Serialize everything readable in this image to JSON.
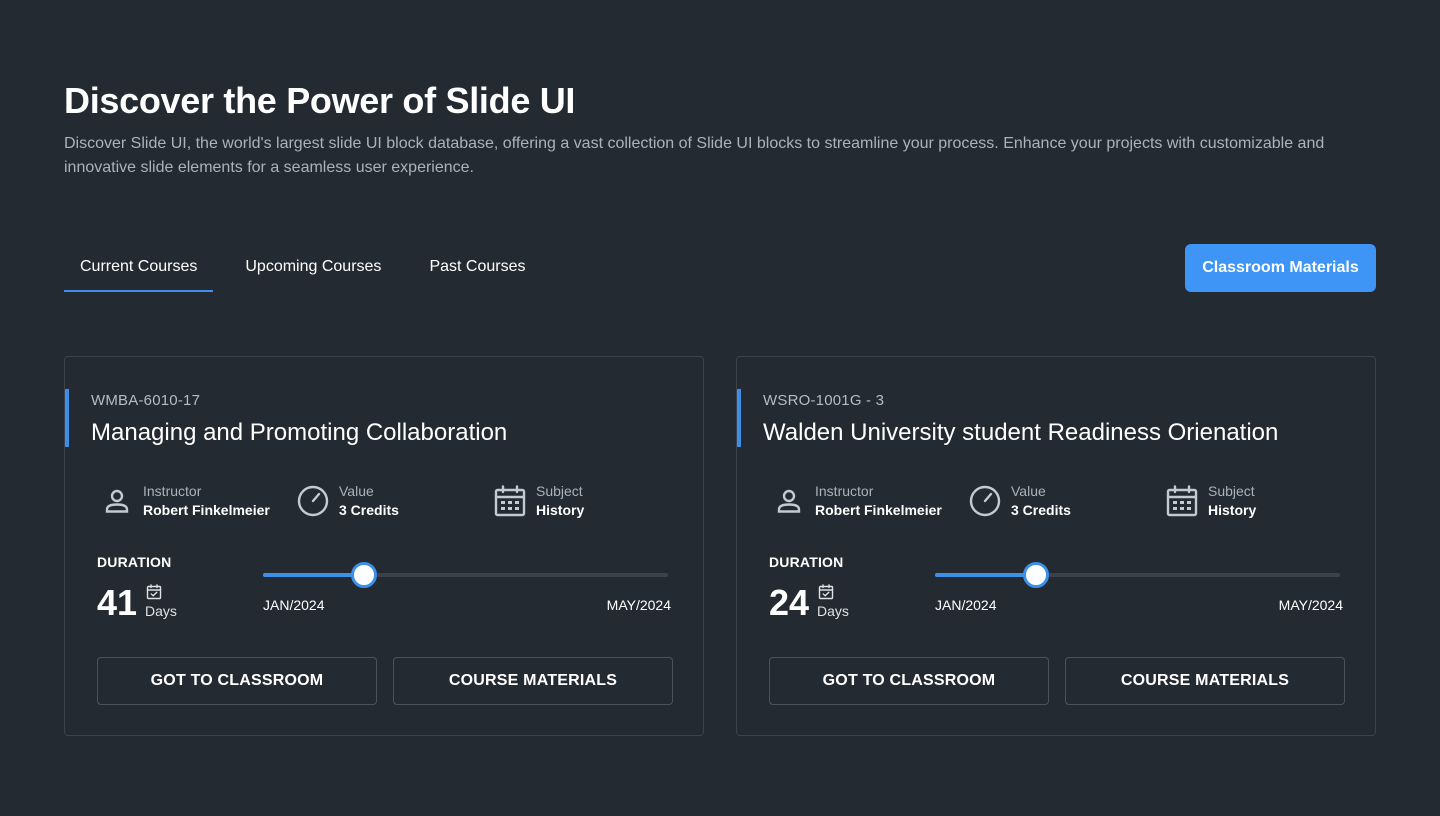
{
  "hero": {
    "title": "Discover the Power of Slide UI",
    "description": "Discover Slide UI, the world's largest slide UI block database, offering a vast collection of Slide UI blocks to streamline your process. Enhance your projects with customizable and innovative slide elements for a seamless user experience."
  },
  "tabs": [
    {
      "label": "Current Courses",
      "active": true
    },
    {
      "label": "Upcoming Courses",
      "active": false
    },
    {
      "label": "Past Courses",
      "active": false
    }
  ],
  "cta": {
    "label": "Classroom Materials"
  },
  "colors": {
    "background": "#242a31",
    "accent": "#3e95f6",
    "card_border": "#3a424d",
    "muted_text": "#aab2bd"
  },
  "courses": [
    {
      "code": "WMBA-6010-17",
      "title": "Managing and Promoting Collaboration",
      "instructor_label": "Instructor",
      "instructor": "Robert Finkelmeier",
      "value_label": "Value",
      "value": "3 Credits",
      "subject_label": "Subject",
      "subject": "History",
      "duration_label": "DURATION",
      "duration_days": "41",
      "duration_unit": "Days",
      "start": "JAN/2024",
      "end": "MAY/2024",
      "progress": 0.25,
      "primary_button": "GOT TO CLASSROOM",
      "secondary_button": "COURSE MATERIALS"
    },
    {
      "code": "WSRO-1001G - 3",
      "title": "Walden University student Readiness Orienation",
      "instructor_label": "Instructor",
      "instructor": "Robert Finkelmeier",
      "value_label": "Value",
      "value": "3 Credits",
      "subject_label": "Subject",
      "subject": "History",
      "duration_label": "DURATION",
      "duration_days": "24",
      "duration_unit": "Days",
      "start": "JAN/2024",
      "end": "MAY/2024",
      "progress": 0.25,
      "primary_button": "GOT TO CLASSROOM",
      "secondary_button": "COURSE MATERIALS"
    }
  ],
  "icons": {
    "instructor": "person-icon",
    "value": "gauge-icon",
    "subject": "calendar-icon",
    "duration": "calendar-check-icon"
  }
}
